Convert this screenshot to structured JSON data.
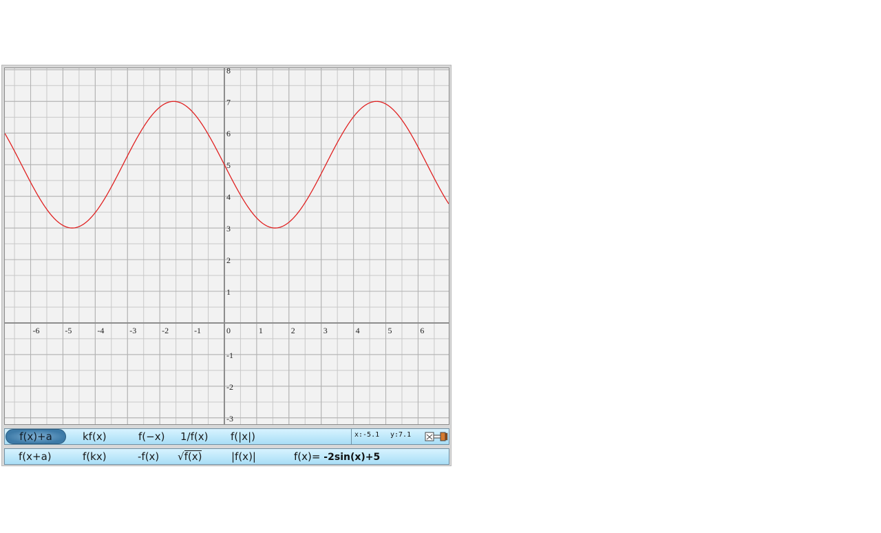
{
  "chart_data": {
    "type": "line",
    "function": "-2sin(x)+5",
    "xlim": [
      -6.8,
      6.95
    ],
    "ylim": [
      -3.2,
      8.05
    ],
    "x_ticks": [
      "-6",
      "-5",
      "-4",
      "-3",
      "-2",
      "-1",
      "0",
      "1",
      "2",
      "3",
      "4",
      "5",
      "6"
    ],
    "y_ticks": [
      "8",
      "7",
      "6",
      "5",
      "4",
      "3",
      "2",
      "1",
      "-1",
      "-2",
      "-3"
    ],
    "grid": true,
    "grid_minor_step": 0.5,
    "series": [
      {
        "color": "#e02020"
      }
    ],
    "axis_color": "#8c8c8c",
    "grid_color": "#c8c8c8"
  },
  "toolbar_top": {
    "buttons": [
      {
        "id": "shift-y",
        "label": "f(x)+a",
        "active": true
      },
      {
        "id": "scale-y",
        "label": "kf(x)",
        "active": false
      },
      {
        "id": "reflect-x",
        "label": "f(−x)",
        "active": false
      },
      {
        "id": "reciprocal",
        "label": "1/f(x)",
        "active": false
      },
      {
        "id": "abs-x",
        "label": "f(|x|)",
        "active": false
      }
    ],
    "coords": {
      "x": "x:-5.1",
      "y": "y:7.1"
    },
    "tool_icon": "eraser-tool-icon"
  },
  "toolbar_bottom": {
    "buttons": [
      {
        "id": "shift-x",
        "label": "f(x+a)"
      },
      {
        "id": "scale-x",
        "label": "f(kx)"
      },
      {
        "id": "reflect-y",
        "label": "-f(x)"
      },
      {
        "id": "sqrt",
        "label": "f(x)",
        "prefix": "√"
      },
      {
        "id": "abs",
        "label": "|f(x)|"
      }
    ],
    "formula_prefix": "f(x)=",
    "formula_expr": " -2sin(x)+5"
  }
}
